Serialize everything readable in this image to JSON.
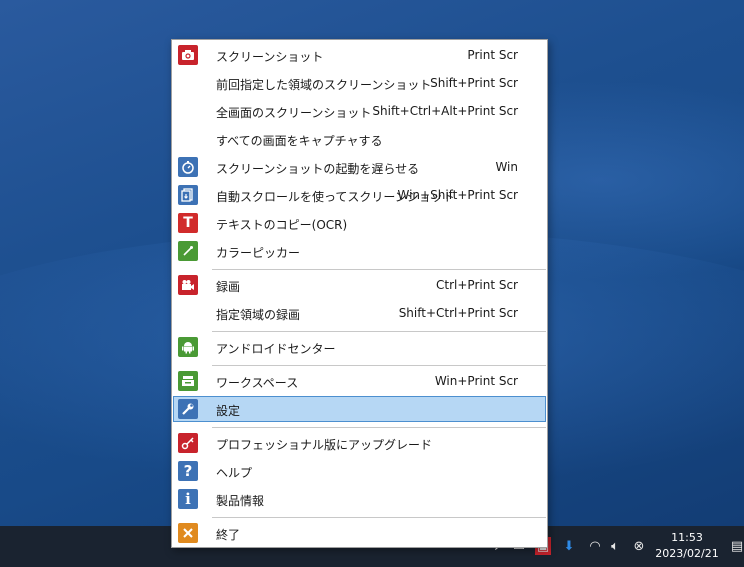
{
  "menu": {
    "items": [
      {
        "label": "スクリーンショット",
        "shortcut": "Print Scr",
        "icon": "camera-icon",
        "color": "#c8232c"
      },
      {
        "label": "前回指定した領域のスクリーンショット",
        "shortcut": "Shift+Print Scr",
        "icon": "",
        "color": ""
      },
      {
        "label": "全画面のスクリーンショット",
        "shortcut": "Shift+Ctrl+Alt+Print Scr",
        "icon": "",
        "color": ""
      },
      {
        "label": "すべての画面をキャプチャする",
        "shortcut": "",
        "icon": "",
        "color": ""
      },
      {
        "label": "スクリーンショットの起動を遅らせる",
        "shortcut": "Win",
        "icon": "stopwatch-icon",
        "color": "#3d72b5"
      },
      {
        "label": "自動スクロールを使ってスクリーンショット",
        "shortcut": "Win+Shift+Print Scr",
        "icon": "scroll-capture-icon",
        "color": "#3d72b5"
      },
      {
        "label": "テキストのコピー(OCR)",
        "shortcut": "",
        "icon": "text-t-icon",
        "color": "#d12b2b"
      },
      {
        "label": "カラーピッカー",
        "shortcut": "",
        "icon": "eyedropper-icon",
        "color": "#4a9a35"
      },
      {
        "label": "録画",
        "shortcut": "Ctrl+Print Scr",
        "icon": "video-camera-icon",
        "color": "#c8232c"
      },
      {
        "label": "指定領域の録画",
        "shortcut": "Shift+Ctrl+Print Scr",
        "icon": "",
        "color": ""
      },
      {
        "label": "アンドロイドセンター",
        "shortcut": "",
        "icon": "android-icon",
        "color": "#4a9a35"
      },
      {
        "label": "ワークスペース",
        "shortcut": "Win+Print Scr",
        "icon": "workspace-icon",
        "color": "#4a9a35"
      },
      {
        "label": "設定",
        "shortcut": "",
        "icon": "wrench-icon",
        "color": "#3d72b5"
      },
      {
        "label": "プロフェッショナル版にアップグレード",
        "shortcut": "",
        "icon": "key-icon",
        "color": "#c8232c"
      },
      {
        "label": "ヘルプ",
        "shortcut": "",
        "icon": "help-icon",
        "color": "#3d72b5"
      },
      {
        "label": "製品情報",
        "shortcut": "",
        "icon": "info-icon",
        "color": "#3d72b5"
      },
      {
        "label": "終了",
        "shortcut": "",
        "icon": "close-icon",
        "color": "#e08a1f"
      }
    ],
    "selected_label": "設定"
  },
  "taskbar": {
    "time": "11:53",
    "date": "2023/02/21"
  }
}
